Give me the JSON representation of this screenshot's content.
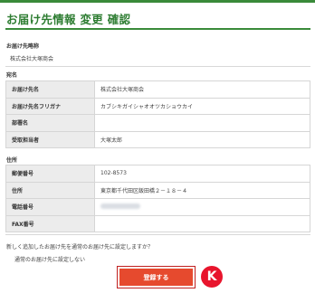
{
  "page": {
    "title": "お届け先情報 変更 確認"
  },
  "recipient_name_section": {
    "label": "お届け先略称",
    "value": "株式会社大塚商会"
  },
  "name_section": {
    "label": "宛名",
    "rows": [
      {
        "label": "お届け先名",
        "value": "株式会社大塚商会"
      },
      {
        "label": "お届け先名フリガナ",
        "value": "カブシキガイシャオオツカショウカイ"
      },
      {
        "label": "部署名",
        "value": ""
      },
      {
        "label": "受取担当者",
        "value": "大塚太郎"
      }
    ]
  },
  "address_section": {
    "label": "住所",
    "rows": [
      {
        "label": "郵便番号",
        "value": "102-8573"
      },
      {
        "label": "住所",
        "value": "東京都千代田区飯田橋２－１８－４"
      },
      {
        "label": "電話番号",
        "value": ""
      },
      {
        "label": "FAX番号",
        "value": ""
      }
    ]
  },
  "question": "新しく追加したお届け先を通常のお届け先に設定しますか？",
  "option": "通常のお届け先に設定しない",
  "register_button": "登録する",
  "step_marker": "K",
  "colors": {
    "brand_green": "#2e7d32",
    "button": "#e64a2e",
    "marker": "#e8152d"
  }
}
